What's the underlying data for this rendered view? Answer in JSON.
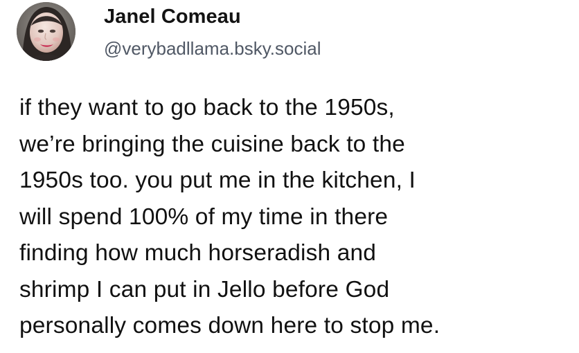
{
  "post": {
    "author": {
      "display_name": "Janel Comeau",
      "handle": "@verybadllama.bsky.social",
      "avatar_icon": "profile-photo"
    },
    "text_lines": [
      "if they want to go back to the 1950s,",
      "we’re bringing the cuisine back to the",
      "1950s too. you put me in the kitchen, I",
      "will spend 100% of my time in there",
      "finding how much horseradish and",
      "shrimp I can put in Jello before God",
      "personally comes down here to stop me."
    ]
  },
  "colors": {
    "background": "#ffffff",
    "text": "#111111",
    "handle": "#505865"
  }
}
